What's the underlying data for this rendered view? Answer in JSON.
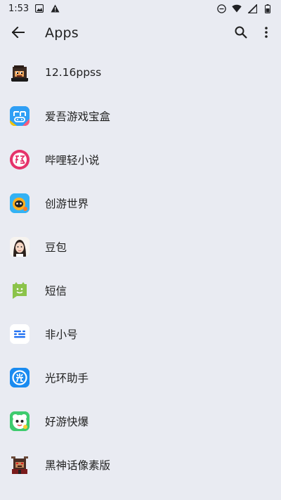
{
  "status_bar": {
    "time": "1:53"
  },
  "header": {
    "title": "Apps"
  },
  "apps": [
    {
      "label": "12.16ppss",
      "icon": "gorilla-pixel-icon"
    },
    {
      "label": "爱吾游戏宝盒",
      "icon": "game-box-icon"
    },
    {
      "label": "哔哩轻小说",
      "icon": "bili-light-novel-icon"
    },
    {
      "label": "创游世界",
      "icon": "chuangyou-icon"
    },
    {
      "label": "豆包",
      "icon": "doubao-avatar-icon"
    },
    {
      "label": "短信",
      "icon": "messages-icon"
    },
    {
      "label": "非小号",
      "icon": "feixiaohao-icon"
    },
    {
      "label": "光环助手",
      "icon": "guanghuan-icon"
    },
    {
      "label": "好游快爆",
      "icon": "haoyou-icon"
    },
    {
      "label": "黑神话像素版",
      "icon": "wukong-pixel-icon"
    }
  ]
}
